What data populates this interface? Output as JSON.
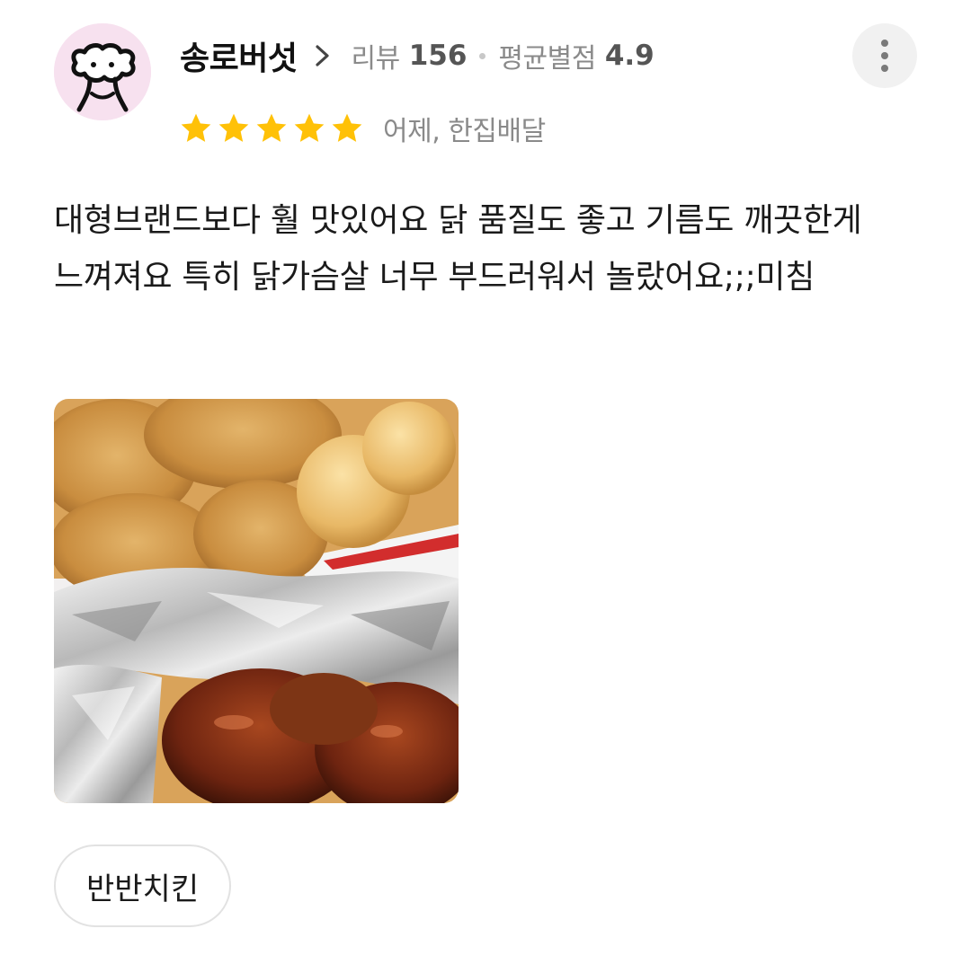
{
  "reviewer": {
    "nickname": "송로버섯",
    "avatar_icon": "sheep-dog-avatar-icon",
    "avatar_bg": "#f7e1ef",
    "review_count_label": "리뷰",
    "review_count": "156",
    "avg_rating_label": "평균별점",
    "avg_rating": "4.9"
  },
  "review": {
    "rating": 5,
    "max_rating": 5,
    "star_color": "#ffc107",
    "date_and_method": "어제, 한집배달",
    "text": "대형브랜드보다 훨 맛있어요 닭 품질도 좋고 기름도 깨끗한게 느껴져요 특히 닭가슴살 너무 부드러워서 놀랐어요;;;미침",
    "photo": "fried-chicken-photo",
    "menu_tag": "반반치킨"
  },
  "actions": {
    "more_icon": "more-vertical-icon",
    "chevron_icon": "chevron-right-icon"
  }
}
